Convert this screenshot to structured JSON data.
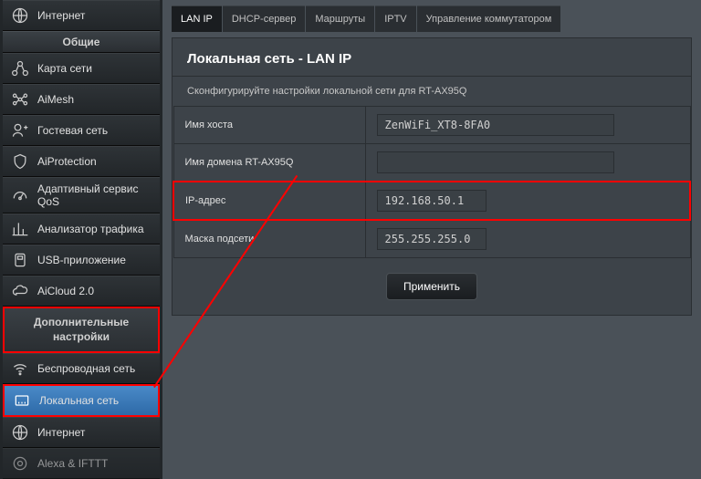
{
  "sidebar": {
    "top_item": "Интернет",
    "section_general": "Общие",
    "general_items": [
      "Карта сети",
      "AiMesh",
      "Гостевая сеть",
      "AiProtection",
      "Адаптивный сервис QoS",
      "Анализатор трафика",
      "USB-приложение",
      "AiCloud 2.0"
    ],
    "section_advanced": "Дополнительные настройки",
    "advanced_items": [
      "Беспроводная сеть",
      "Локальная сеть",
      "Интернет",
      "Alexa & IFTTT"
    ]
  },
  "tabs": [
    "LAN IP",
    "DHCP-сервер",
    "Маршруты",
    "IPTV",
    "Управление коммутатором"
  ],
  "panel": {
    "title": "Локальная сеть - LAN IP",
    "description": "Сконфигурируйте настройки локальной сети для RT-AX95Q",
    "rows": [
      {
        "label": "Имя хоста",
        "value": "ZenWiFi_XT8-8FA0"
      },
      {
        "label": "Имя домена RT-AX95Q",
        "value": ""
      },
      {
        "label": "IP-адрес",
        "value": "192.168.50.1"
      },
      {
        "label": "Маска подсети",
        "value": "255.255.255.0"
      }
    ],
    "apply": "Применить"
  }
}
